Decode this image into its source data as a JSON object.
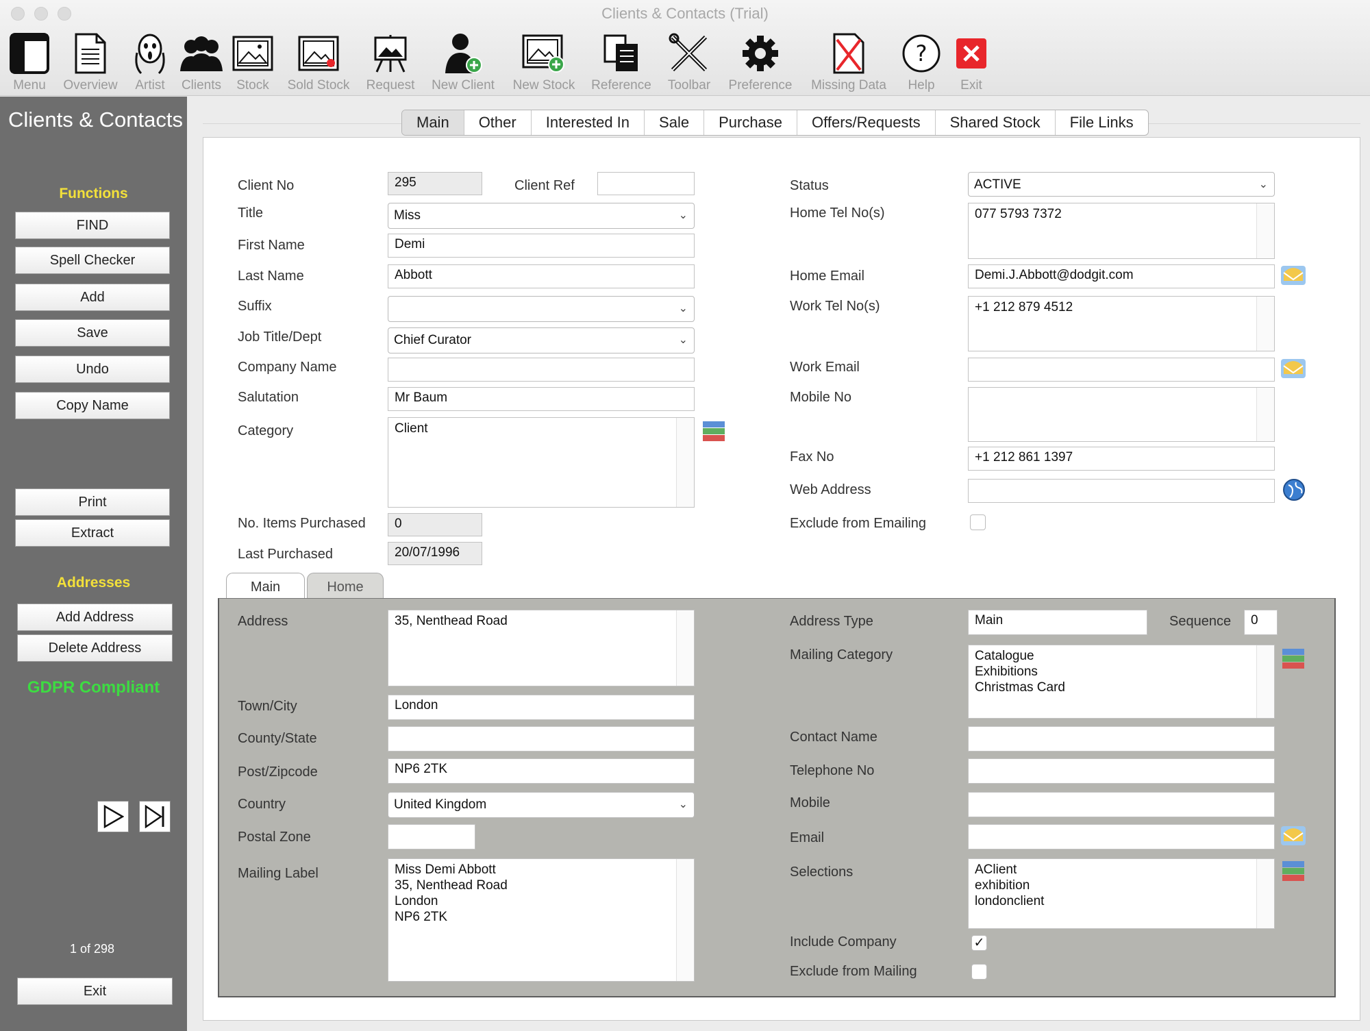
{
  "window": {
    "title": "Clients & Contacts (Trial)"
  },
  "toolbar": [
    {
      "id": "menu",
      "label": "Menu",
      "icon": "menu-icon"
    },
    {
      "id": "overview",
      "label": "Overview",
      "icon": "document-icon"
    },
    {
      "id": "artist",
      "label": "Artist",
      "icon": "scream-face-icon"
    },
    {
      "id": "clients",
      "label": "Clients",
      "icon": "people-icon"
    },
    {
      "id": "stock",
      "label": "Stock",
      "icon": "picture-icon"
    },
    {
      "id": "sold-stock",
      "label": "Sold Stock",
      "icon": "sold-picture-icon"
    },
    {
      "id": "request",
      "label": "Request",
      "icon": "easel-icon"
    },
    {
      "id": "new-client",
      "label": "New Client",
      "icon": "add-person-icon"
    },
    {
      "id": "new-stock",
      "label": "New Stock",
      "icon": "add-picture-icon"
    },
    {
      "id": "reference",
      "label": "Reference",
      "icon": "copy-icon"
    },
    {
      "id": "toolbar",
      "label": "Toolbar",
      "icon": "tools-icon"
    },
    {
      "id": "preference",
      "label": "Preference",
      "icon": "gear-icon"
    },
    {
      "id": "missing-data",
      "label": "Missing Data",
      "icon": "missing-file-icon"
    },
    {
      "id": "help",
      "label": "Help",
      "icon": "help-icon"
    },
    {
      "id": "exit",
      "label": "Exit",
      "icon": "close-icon"
    }
  ],
  "sidebar": {
    "title": "Clients & Contacts",
    "functions_heading": "Functions",
    "buttons": {
      "find": "FIND",
      "spell": "Spell Checker",
      "add": "Add",
      "save": "Save",
      "undo": "Undo",
      "copy_name": "Copy Name",
      "print": "Print",
      "extract": "Extract",
      "add_address": "Add Address",
      "delete_address": "Delete Address",
      "exit": "Exit"
    },
    "addresses_heading": "Addresses",
    "gdpr": "GDPR Compliant",
    "record_counter": "1 of  298"
  },
  "tabs": [
    "Main",
    "Other",
    "Interested In",
    "Sale",
    "Purchase",
    "Offers/Requests",
    "Shared Stock",
    "File Links"
  ],
  "form": {
    "client_no": {
      "label": "Client No",
      "value": "295"
    },
    "client_ref": {
      "label": "Client Ref",
      "value": ""
    },
    "title": {
      "label": "Title",
      "value": "Miss"
    },
    "first_name": {
      "label": "First Name",
      "value": "Demi"
    },
    "last_name": {
      "label": "Last Name",
      "value": "Abbott"
    },
    "suffix": {
      "label": "Suffix",
      "value": ""
    },
    "job_title": {
      "label": "Job Title/Dept",
      "value": "Chief Curator"
    },
    "company": {
      "label": "Company Name",
      "value": ""
    },
    "salutation": {
      "label": "Salutation",
      "value": "Mr Baum"
    },
    "category": {
      "label": "Category",
      "value": "Client"
    },
    "items_purchased": {
      "label": "No. Items Purchased",
      "value": "0"
    },
    "last_purchased": {
      "label": "Last Purchased",
      "value": "20/07/1996"
    },
    "status": {
      "label": "Status",
      "value": "ACTIVE"
    },
    "home_tel": {
      "label": "Home Tel No(s)",
      "value": "077 5793 7372"
    },
    "home_email": {
      "label": "Home Email",
      "value": "Demi.J.Abbott@dodgit.com"
    },
    "work_tel": {
      "label": "Work Tel No(s)",
      "value": "+1 212 879 4512"
    },
    "work_email": {
      "label": "Work Email",
      "value": ""
    },
    "mobile": {
      "label": "Mobile No",
      "value": ""
    },
    "fax": {
      "label": "Fax No",
      "value": "+1 212 861 1397"
    },
    "web": {
      "label": "Web Address",
      "value": ""
    },
    "exclude_email": {
      "label": "Exclude from Emailing",
      "checked": false
    }
  },
  "address_tabs": [
    "Main",
    "Home"
  ],
  "address": {
    "address": {
      "label": "Address",
      "value": "35, Nenthead Road"
    },
    "town": {
      "label": "Town/City",
      "value": "London"
    },
    "county": {
      "label": "County/State",
      "value": ""
    },
    "postcode": {
      "label": "Post/Zipcode",
      "value": "NP6 2TK"
    },
    "country": {
      "label": "Country",
      "value": "United Kingdom"
    },
    "postal_zone": {
      "label": "Postal Zone",
      "value": ""
    },
    "mailing_label": {
      "label": "Mailing Label",
      "value": "Miss Demi Abbott\n35, Nenthead Road\nLondon\nNP6 2TK"
    },
    "address_type": {
      "label": "Address Type",
      "value": "Main"
    },
    "sequence": {
      "label": "Sequence",
      "value": "0"
    },
    "mailing_category": {
      "label": "Mailing Category",
      "value": "Catalogue\nExhibitions\nChristmas Card"
    },
    "contact_name": {
      "label": "Contact Name",
      "value": ""
    },
    "telephone": {
      "label": "Telephone No",
      "value": ""
    },
    "mobile": {
      "label": "Mobile",
      "value": ""
    },
    "email": {
      "label": "Email",
      "value": ""
    },
    "selections": {
      "label": "Selections",
      "value": "AClient\nexhibition\nlondonclient"
    },
    "include_company": {
      "label": "Include Company",
      "checked": true
    },
    "exclude_mailing": {
      "label": "Exclude from Mailing",
      "checked": false
    }
  },
  "colors": {
    "sidebar": "#6e6e6e",
    "heading": "#f3e03a",
    "gdpr": "#3ddc42",
    "exit_red": "#e8262b"
  }
}
